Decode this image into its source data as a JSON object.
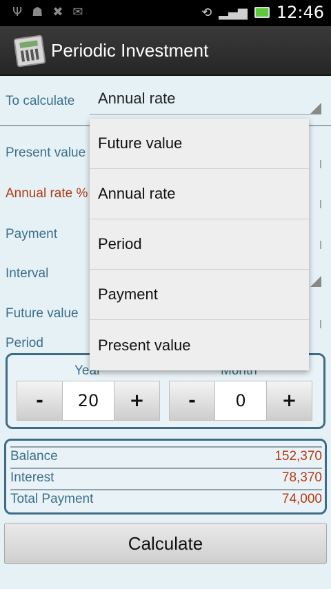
{
  "status_bar": {
    "time": "12:46",
    "icons": [
      "usb-icon",
      "android-debug-icon",
      "sim-icon",
      "gmail-icon",
      "rotate-icon",
      "signal-icon",
      "battery-icon"
    ]
  },
  "app": {
    "title": "Periodic Investment"
  },
  "form": {
    "to_calculate_label": "To calculate",
    "to_calculate_value": "Annual rate",
    "present_value_label": "Present value",
    "annual_rate_label": "Annual rate %",
    "payment_label": "Payment",
    "interval_label": "Interval",
    "future_value_label": "Future value",
    "period_label": "Period"
  },
  "period": {
    "year_label": "Year",
    "year_value": "20",
    "month_label": "Month",
    "month_value": "0",
    "minus": "-",
    "plus": "+"
  },
  "results": [
    {
      "label": "Balance",
      "value": "152,370"
    },
    {
      "label": "Interest",
      "value": "78,370"
    },
    {
      "label": "Total Payment",
      "value": "74,000"
    }
  ],
  "calculate_button": "Calculate",
  "dropdown": {
    "options": [
      "Future value",
      "Annual rate",
      "Period",
      "Payment",
      "Present value"
    ]
  },
  "colors": {
    "label_blue": "#3b6f8c",
    "value_red": "#b23a12",
    "background": "#e6f1f6"
  }
}
